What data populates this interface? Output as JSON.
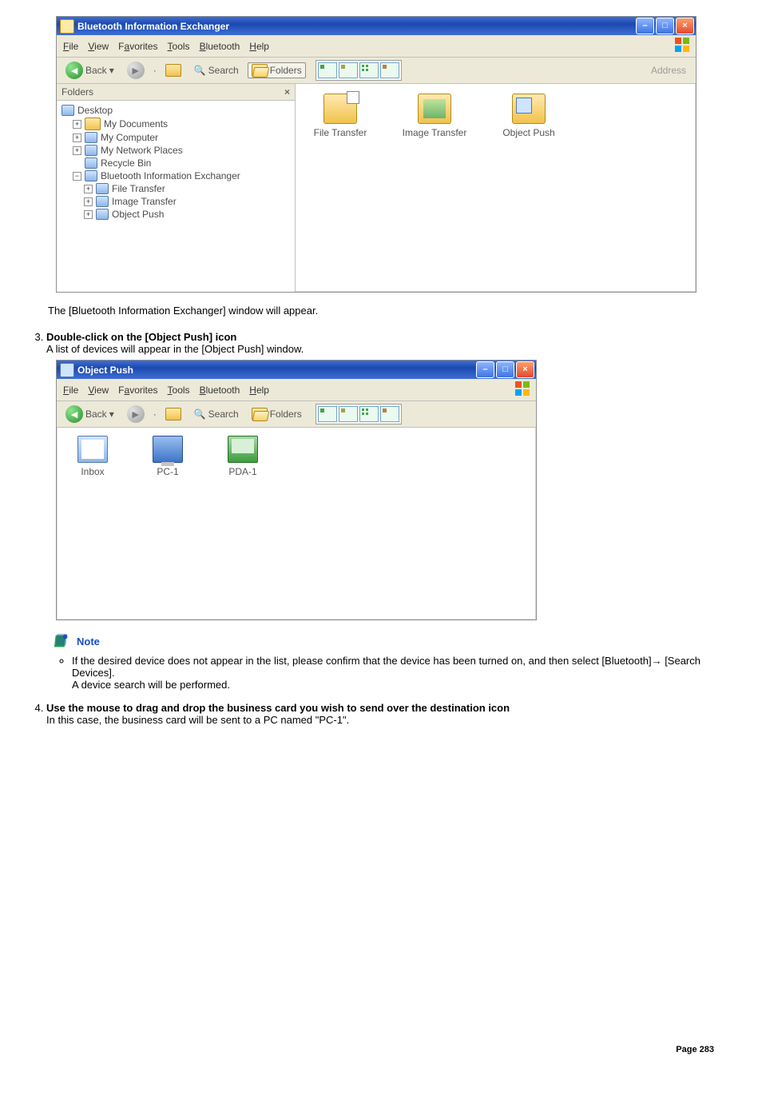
{
  "win1": {
    "title": "Bluetooth Information Exchanger",
    "menus": {
      "file": "File",
      "view": "View",
      "fav": "Favorites",
      "tools": "Tools",
      "bt": "Bluetooth",
      "help": "Help"
    },
    "toolbar": {
      "back": "Back",
      "search": "Search",
      "folders": "Folders",
      "address": "Address"
    },
    "folders_header": "Folders",
    "tree": {
      "desktop": "Desktop",
      "mydocs": "My Documents",
      "mycomp": "My Computer",
      "mynet": "My Network Places",
      "recycle": "Recycle Bin",
      "bie": "Bluetooth Information Exchanger",
      "ft": "File Transfer",
      "it": "Image Transfer",
      "op": "Object Push"
    },
    "content": {
      "ft": "File Transfer",
      "it": "Image Transfer",
      "op": "Object Push"
    }
  },
  "caption1": "The [Bluetooth Information Exchanger] window will appear.",
  "step3": {
    "head": "Double-click on the [Object Push] icon",
    "body": "A list of devices will appear in the [Object Push] window."
  },
  "win2": {
    "title": "Object Push",
    "menus": {
      "file": "File",
      "view": "View",
      "fav": "Favorites",
      "tools": "Tools",
      "bt": "Bluetooth",
      "help": "Help"
    },
    "toolbar": {
      "back": "Back",
      "search": "Search",
      "folders": "Folders"
    },
    "items": {
      "inbox": "Inbox",
      "pc": "PC-1",
      "pda": "PDA-1"
    }
  },
  "note": {
    "label": "Note",
    "line1": "If the desired device does not appear in the list, please confirm that the device has been turned on, and then select [Bluetooth]→ [Search Devices].",
    "line2": "A device search will be performed."
  },
  "step4": {
    "head": "Use the mouse to drag and drop the business card you wish to send over the destination icon",
    "body": "In this case, the business card will be sent to a PC named \"PC-1\"."
  },
  "page": {
    "label": "Page",
    "num": "283"
  }
}
